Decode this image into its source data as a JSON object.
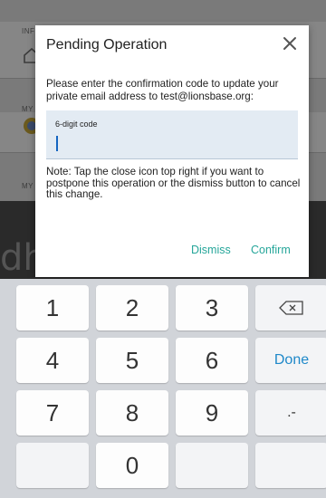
{
  "background": {
    "section1_label": "INF",
    "section2_label": "MY",
    "section3_label": "MY",
    "banner_text": "dhe"
  },
  "dialog": {
    "title": "Pending Operation",
    "close_icon": "close-icon",
    "message": "Please enter the confirmation code to update your private email address to test@lionsbase.org:",
    "code_field": {
      "label": "6-digit code",
      "value": ""
    },
    "note": "Note: Tap the close icon top right if you want to postpone this operation or the dismiss button to cancel this change.",
    "dismiss_label": "Dismiss",
    "confirm_label": "Confirm",
    "accent_color": "#26a69a"
  },
  "keyboard": {
    "key_1": "1",
    "key_2": "2",
    "key_3": "3",
    "key_4": "4",
    "key_5": "5",
    "key_6": "6",
    "key_7": "7",
    "key_8": "8",
    "key_9": "9",
    "key_0": "0",
    "key_punct": ".-",
    "key_done": "Done",
    "backspace_icon": "backspace-icon",
    "done_color": "#1e88c9"
  }
}
